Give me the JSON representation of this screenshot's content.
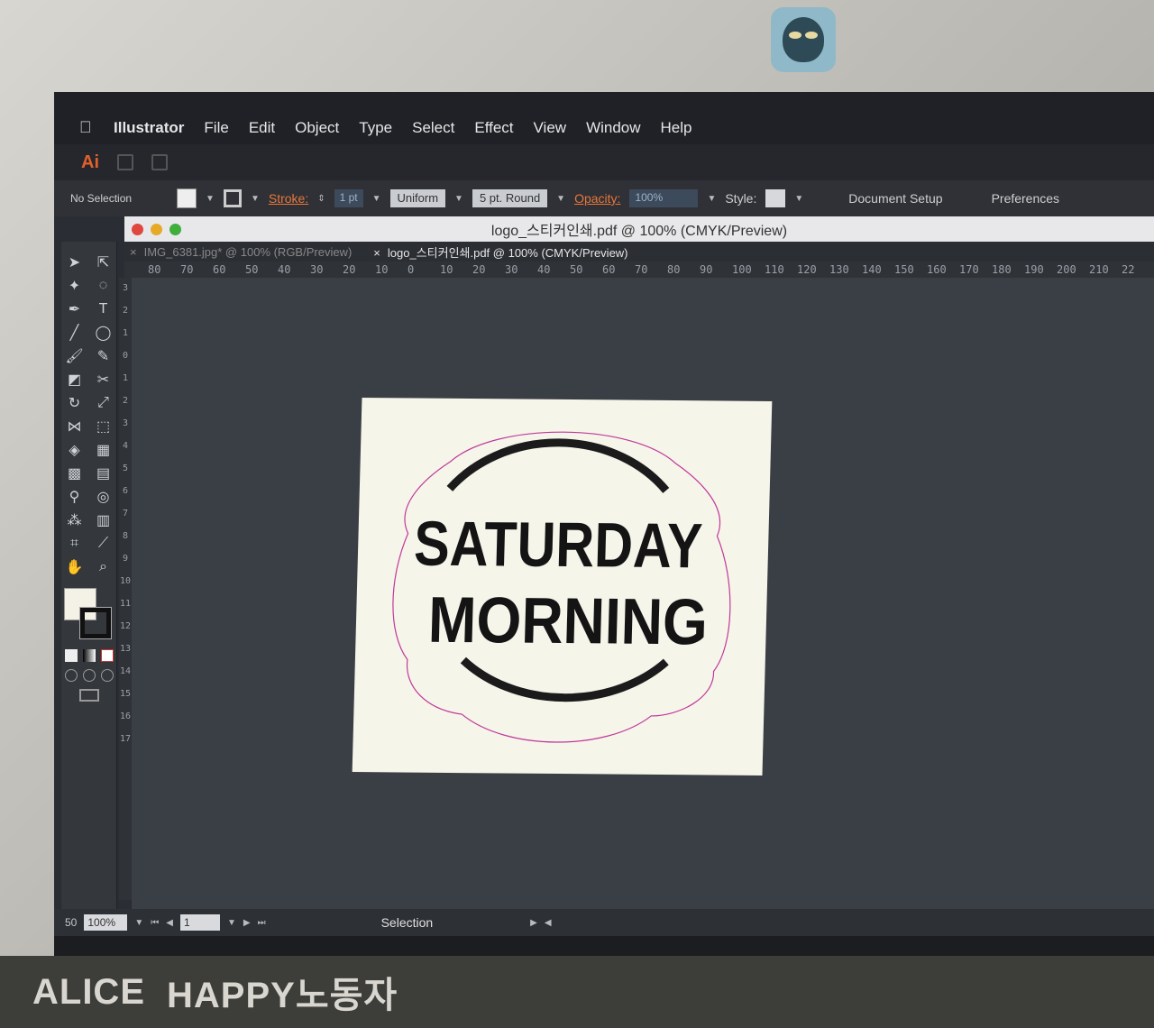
{
  "menubar": {
    "apple": "",
    "items": [
      "Illustrator",
      "File",
      "Edit",
      "Object",
      "Type",
      "Select",
      "Effect",
      "View",
      "Window",
      "Help"
    ]
  },
  "app_logo": "Ai",
  "control": {
    "selection_label": "No Selection",
    "stroke_label": "Stroke:",
    "stroke_value": "1 pt",
    "profile": "Uniform",
    "brush": "5 pt. Round",
    "opacity_label": "Opacity:",
    "opacity_value": "100%",
    "style_label": "Style:",
    "document_setup": "Document Setup",
    "preferences": "Preferences"
  },
  "document": {
    "title": "logo_스티커인쇄.pdf @ 100% (CMYK/Preview)",
    "tabs": [
      {
        "label": "IMG_6381.jpg* @ 100% (RGB/Preview)",
        "active": false
      },
      {
        "label": "logo_스티커인쇄.pdf @ 100% (CMYK/Preview)",
        "active": true
      }
    ]
  },
  "ruler": {
    "h_ticks": [
      "80",
      "70",
      "60",
      "50",
      "40",
      "30",
      "20",
      "10",
      "0",
      "10",
      "20",
      "30",
      "40",
      "50",
      "60",
      "70",
      "80",
      "90",
      "100",
      "110",
      "120",
      "130",
      "140",
      "150",
      "160",
      "170",
      "180",
      "190",
      "200",
      "210",
      "22"
    ],
    "v_ticks": [
      "3",
      "2",
      "1",
      "0",
      "1",
      "2",
      "3",
      "4",
      "5",
      "6",
      "7",
      "8",
      "9",
      "10",
      "11",
      "12",
      "13",
      "14",
      "15",
      "16",
      "17"
    ]
  },
  "artwork": {
    "line1": "SATURDAY",
    "line2": "MORNING",
    "cutline_color": "#c0389a"
  },
  "status": {
    "zoom_prefix": "50",
    "zoom": "100%",
    "page": "1",
    "tool": "Selection"
  },
  "bottom_sticker": {
    "text1": "ALICE",
    "text2": "HAPPY노동자"
  },
  "colors": {
    "accent": "#e8763a",
    "ai_brand": "#e0612d"
  }
}
